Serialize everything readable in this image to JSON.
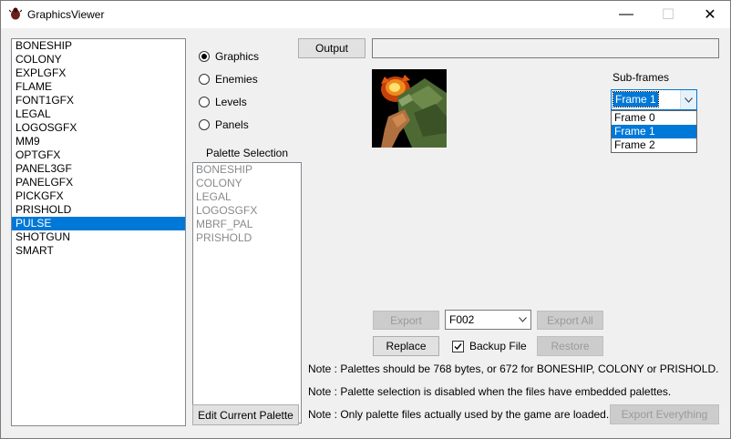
{
  "window": {
    "title": "GraphicsViewer",
    "minimize": "—",
    "maximize": "☐",
    "close": "✕"
  },
  "file_list": {
    "items": [
      "BONESHIP",
      "COLONY",
      "EXPLGFX",
      "FLAME",
      "FONT1GFX",
      "LEGAL",
      "LOGOSGFX",
      "MM9",
      "OPTGFX",
      "PANEL3GF",
      "PANELGFX",
      "PICKGFX",
      "PRISHOLD",
      "PULSE",
      "SHOTGUN",
      "SMART"
    ],
    "selected": "PULSE"
  },
  "mode_radios": {
    "options": [
      "Graphics",
      "Enemies",
      "Levels",
      "Panels"
    ],
    "selected": "Graphics"
  },
  "palette": {
    "label": "Palette Selection",
    "items": [
      "BONESHIP",
      "COLONY",
      "LEGAL",
      "LOGOSGFX",
      "MBRF_PAL",
      "PRISHOLD"
    ],
    "edit_button": "Edit Current Palette"
  },
  "output": {
    "button": "Output",
    "value": ""
  },
  "subframes": {
    "label": "Sub-frames",
    "selected": "Frame 1",
    "options": [
      "Frame 0",
      "Frame 1",
      "Frame 2"
    ]
  },
  "export": {
    "export_button": "Export",
    "file_value": "F002",
    "export_all_button": "Export All",
    "replace_button": "Replace",
    "backup_label": "Backup File",
    "backup_checked": true,
    "restore_button": "Restore",
    "export_everything_button": "Export Everything"
  },
  "notes": [
    "Note : Palettes should be 768 bytes, or 672 for BONESHIP, COLONY or PRISHOLD.",
    "Note : Palette selection is disabled when the files have embedded palettes.",
    "Note : Only palette files actually used by the game are loaded."
  ],
  "icons": {
    "app": "app-bug-icon",
    "dropdown": "chevron-down-icon",
    "check": "checkmark-icon"
  },
  "colors": {
    "selection": "#0078d7",
    "window_bg": "#f0f0f0"
  }
}
